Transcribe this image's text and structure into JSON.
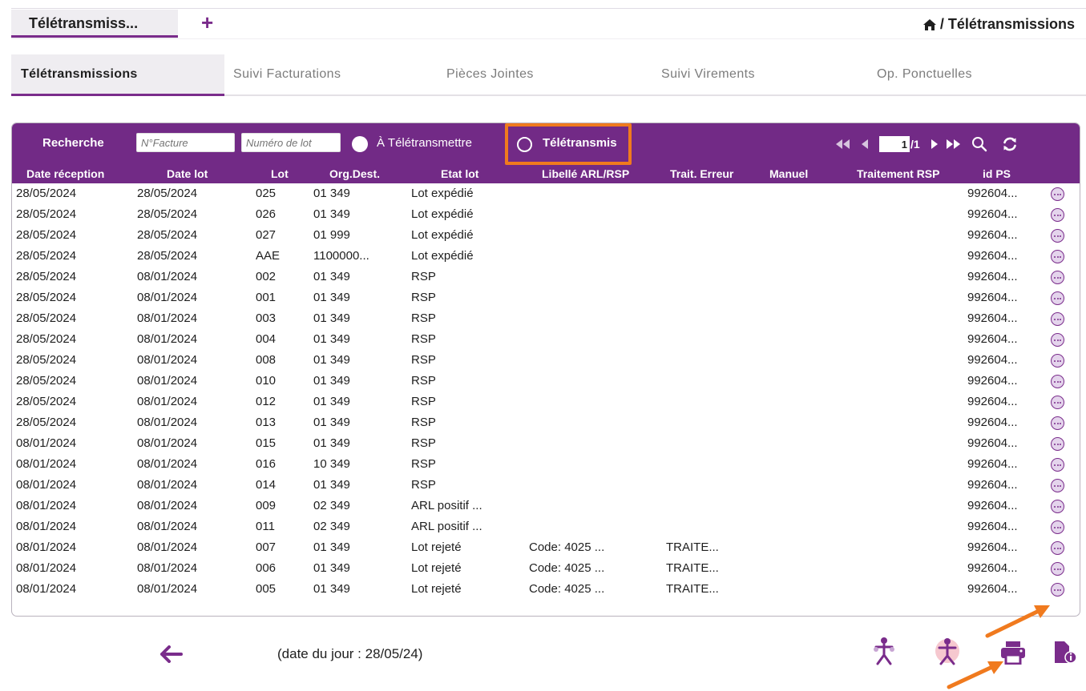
{
  "top_tab": {
    "label": "Télétransmiss...",
    "add_label": "+"
  },
  "breadcrumb": {
    "text": "/ Télétransmissions"
  },
  "sub_tabs": [
    "Télétransmissions",
    "Suivi Facturations",
    "Pièces Jointes",
    "Suivi Virements",
    "Op. Ponctuelles"
  ],
  "toolbar": {
    "search_label": "Recherche",
    "facture_placeholder": "N°Facture",
    "lot_placeholder": "Numéro de lot",
    "radio_a_label": "À Télétransmettre",
    "radio_b_label": "Télétransmis",
    "page_current": "1",
    "page_total": "/1"
  },
  "columns": [
    "Date réception",
    "Date lot",
    "Lot",
    "Org.Dest.",
    "Etat lot",
    "Libellé ARL/RSP",
    "Trait. Erreur",
    "Manuel",
    "Traitement RSP",
    "id PS"
  ],
  "rows": [
    [
      "28/05/2024",
      "28/05/2024",
      "025",
      "01 349",
      "Lot expédié",
      "",
      "",
      "",
      "",
      "992604..."
    ],
    [
      "28/05/2024",
      "28/05/2024",
      "026",
      "01 349",
      "Lot expédié",
      "",
      "",
      "",
      "",
      "992604..."
    ],
    [
      "28/05/2024",
      "28/05/2024",
      "027",
      "01 999",
      "Lot expédié",
      "",
      "",
      "",
      "",
      "992604..."
    ],
    [
      "28/05/2024",
      "28/05/2024",
      "AAE",
      "1100000...",
      "Lot expédié",
      "",
      "",
      "",
      "",
      "992604..."
    ],
    [
      "28/05/2024",
      "08/01/2024",
      "002",
      "01 349",
      "RSP",
      "",
      "",
      "",
      "",
      "992604..."
    ],
    [
      "28/05/2024",
      "08/01/2024",
      "001",
      "01 349",
      "RSP",
      "",
      "",
      "",
      "",
      "992604..."
    ],
    [
      "28/05/2024",
      "08/01/2024",
      "003",
      "01 349",
      "RSP",
      "",
      "",
      "",
      "",
      "992604..."
    ],
    [
      "28/05/2024",
      "08/01/2024",
      "004",
      "01 349",
      "RSP",
      "",
      "",
      "",
      "",
      "992604..."
    ],
    [
      "28/05/2024",
      "08/01/2024",
      "008",
      "01 349",
      "RSP",
      "",
      "",
      "",
      "",
      "992604..."
    ],
    [
      "28/05/2024",
      "08/01/2024",
      "010",
      "01 349",
      "RSP",
      "",
      "",
      "",
      "",
      "992604..."
    ],
    [
      "28/05/2024",
      "08/01/2024",
      "012",
      "01 349",
      "RSP",
      "",
      "",
      "",
      "",
      "992604..."
    ],
    [
      "28/05/2024",
      "08/01/2024",
      "013",
      "01 349",
      "RSP",
      "",
      "",
      "",
      "",
      "992604..."
    ],
    [
      "08/01/2024",
      "08/01/2024",
      "015",
      "01 349",
      "RSP",
      "",
      "",
      "",
      "",
      "992604..."
    ],
    [
      "08/01/2024",
      "08/01/2024",
      "016",
      "10 349",
      "RSP",
      "",
      "",
      "",
      "",
      "992604..."
    ],
    [
      "08/01/2024",
      "08/01/2024",
      "014",
      "01 349",
      "RSP",
      "",
      "",
      "",
      "",
      "992604..."
    ],
    [
      "08/01/2024",
      "08/01/2024",
      "009",
      "02 349",
      "ARL positif ...",
      "",
      "",
      "",
      "",
      "992604..."
    ],
    [
      "08/01/2024",
      "08/01/2024",
      "011",
      "02 349",
      "ARL positif ...",
      "",
      "",
      "",
      "",
      "992604..."
    ],
    [
      "08/01/2024",
      "08/01/2024",
      "007",
      "01 349",
      "Lot rejeté",
      "Code: 4025 ...",
      "TRAITE...",
      "",
      "",
      "992604..."
    ],
    [
      "08/01/2024",
      "08/01/2024",
      "006",
      "01 349",
      "Lot rejeté",
      "Code: 4025 ...",
      "TRAITE...",
      "",
      "",
      "992604..."
    ],
    [
      "08/01/2024",
      "08/01/2024",
      "005",
      "01 349",
      "Lot rejeté",
      "Code: 4025 ...",
      "TRAITE...",
      "",
      "",
      "992604..."
    ]
  ],
  "footer": {
    "date_text": "(date du jour : 28/05/24)"
  },
  "colors": {
    "accent": "#722a86",
    "highlight": "#f07a1e",
    "tab_bg": "#efedf1"
  }
}
